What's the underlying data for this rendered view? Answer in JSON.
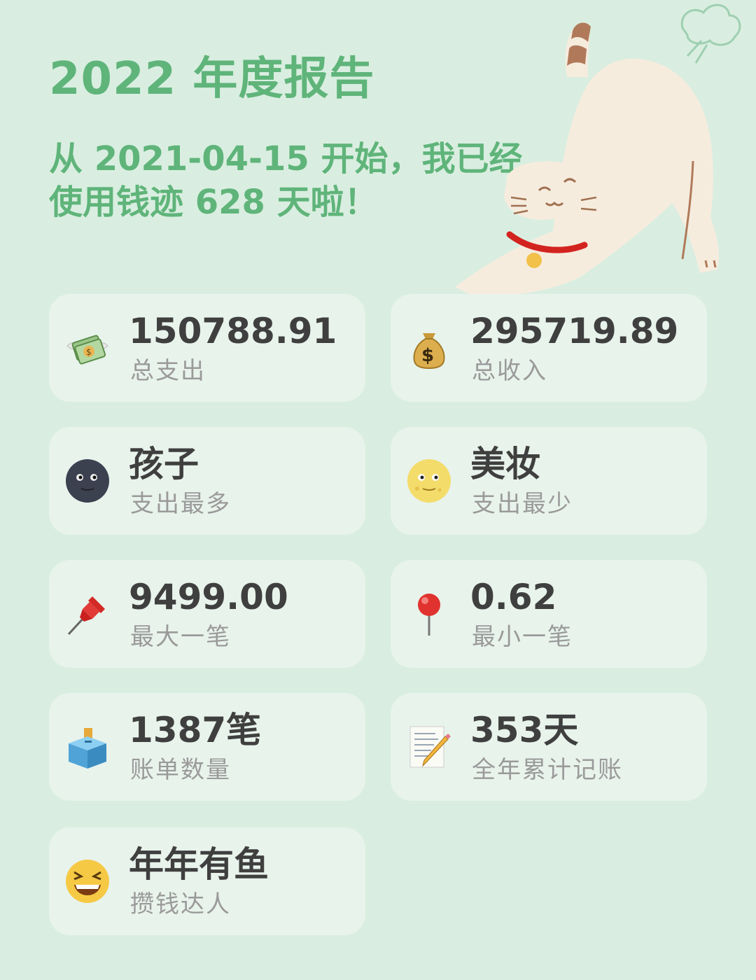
{
  "header": {
    "title": "2022 年度报告",
    "subtitle": "从 2021-04-15 开始，我已经使用钱迹 628 天啦！"
  },
  "stats": [
    {
      "icon": "money-with-wings-icon",
      "value": "150788.91",
      "label": "总支出"
    },
    {
      "icon": "money-bag-icon",
      "value": "295719.89",
      "label": "总收入"
    },
    {
      "icon": "new-moon-face-icon",
      "value": "孩子",
      "label": "支出最多"
    },
    {
      "icon": "full-moon-face-icon",
      "value": "美妆",
      "label": "支出最少"
    },
    {
      "icon": "pushpin-icon",
      "value": "9499.00",
      "label": "最大一笔"
    },
    {
      "icon": "round-pushpin-icon",
      "value": "0.62",
      "label": "最小一笔"
    },
    {
      "icon": "ballot-box-icon",
      "value": "1387笔",
      "label": "账单数量"
    },
    {
      "icon": "memo-icon",
      "value": "353天",
      "label": "全年累计记账"
    },
    {
      "icon": "laughing-face-icon",
      "value": "年年有鱼",
      "label": "攒钱达人"
    }
  ],
  "colors": {
    "background": "#d9eee0",
    "card": "#e8f3ec",
    "accent": "#5fb47a",
    "value_text": "#3f3f3f",
    "label_text": "#9a9a9a"
  }
}
